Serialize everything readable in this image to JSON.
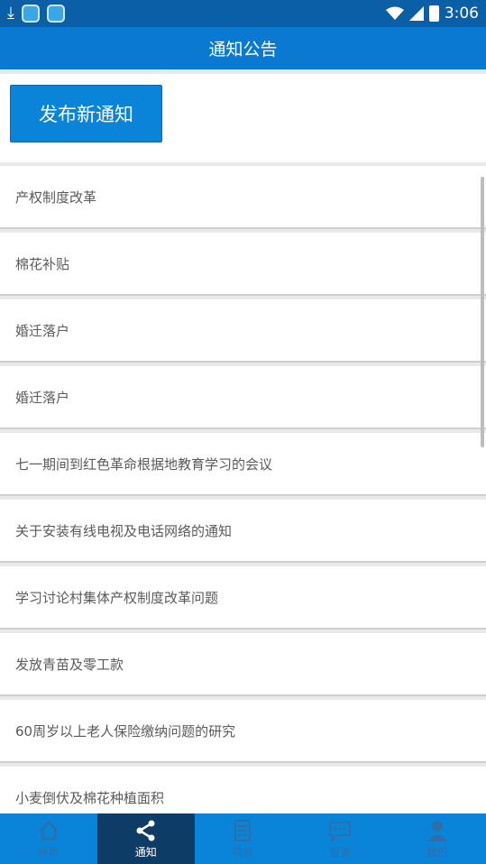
{
  "status_bar": {
    "time": "3:06",
    "icons": [
      "download-icon",
      "app-icon",
      "app-icon",
      "wifi-icon",
      "signal-icon",
      "battery-icon"
    ]
  },
  "title": "通知公告",
  "publish_button_label": "发布新通知",
  "notices": [
    "产权制度改革",
    "棉花补贴",
    "婚迁落户",
    "婚迁落户",
    "七一期间到红色革命根据地教育学习的会议",
    "关于安装有线电视及电话网络的通知",
    "学习讨论村集体产权制度改革问题",
    "发放青苗及零工款",
    "60周岁以上老人保险缴纳问题的研究",
    "小麦倒伏及棉花种植面积"
  ],
  "nav": [
    {
      "label": "首页",
      "icon": "home-icon"
    },
    {
      "label": "通知",
      "icon": "share-icon",
      "active": true
    },
    {
      "label": "项目",
      "icon": "list-icon"
    },
    {
      "label": "留言",
      "icon": "message-icon"
    },
    {
      "label": "我的",
      "icon": "person-icon"
    }
  ],
  "colors": {
    "primary": "#0a79d1",
    "status_bar": "#0a5fa6",
    "nav_active": "#0d3d66",
    "nav_bg": "#0a84d8"
  }
}
